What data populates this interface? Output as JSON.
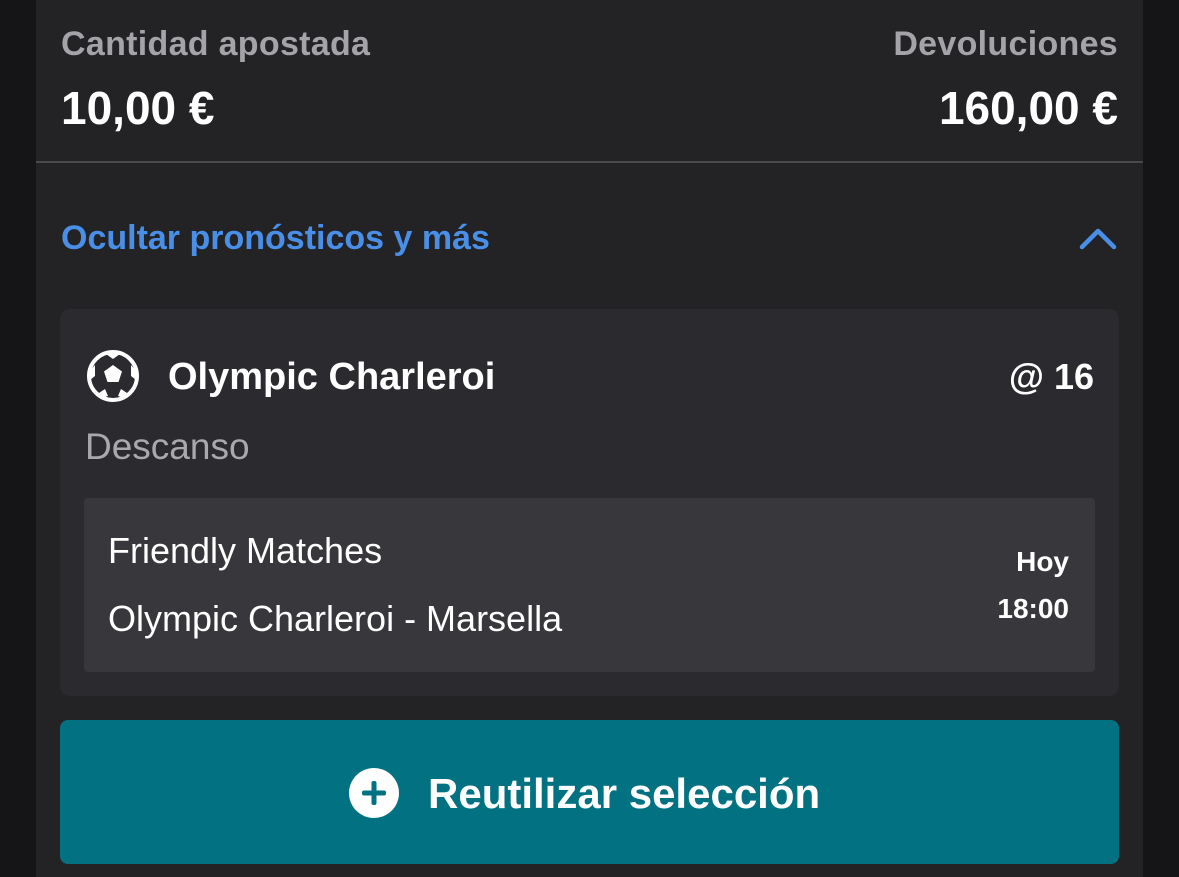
{
  "stake": {
    "label": "Cantidad apostada",
    "amount": "10,00 €"
  },
  "returns": {
    "label": "Devoluciones",
    "amount": "160,00 €"
  },
  "toggle": {
    "label": "Ocultar pronósticos y más",
    "icon": "chevron-up-icon",
    "accent_color": "#4a8fe7"
  },
  "selection": {
    "sport_icon": "soccer-ball-icon",
    "name": "Olympic Charleroi",
    "odds": "@ 16",
    "market": "Descanso",
    "event": {
      "competition": "Friendly Matches",
      "fixture": "Olympic Charleroi - Marsella",
      "day": "Hoy",
      "time": "18:00"
    }
  },
  "reuse_button": {
    "label": "Reutilizar selección",
    "icon": "plus-circle-icon",
    "color": "#027283"
  }
}
